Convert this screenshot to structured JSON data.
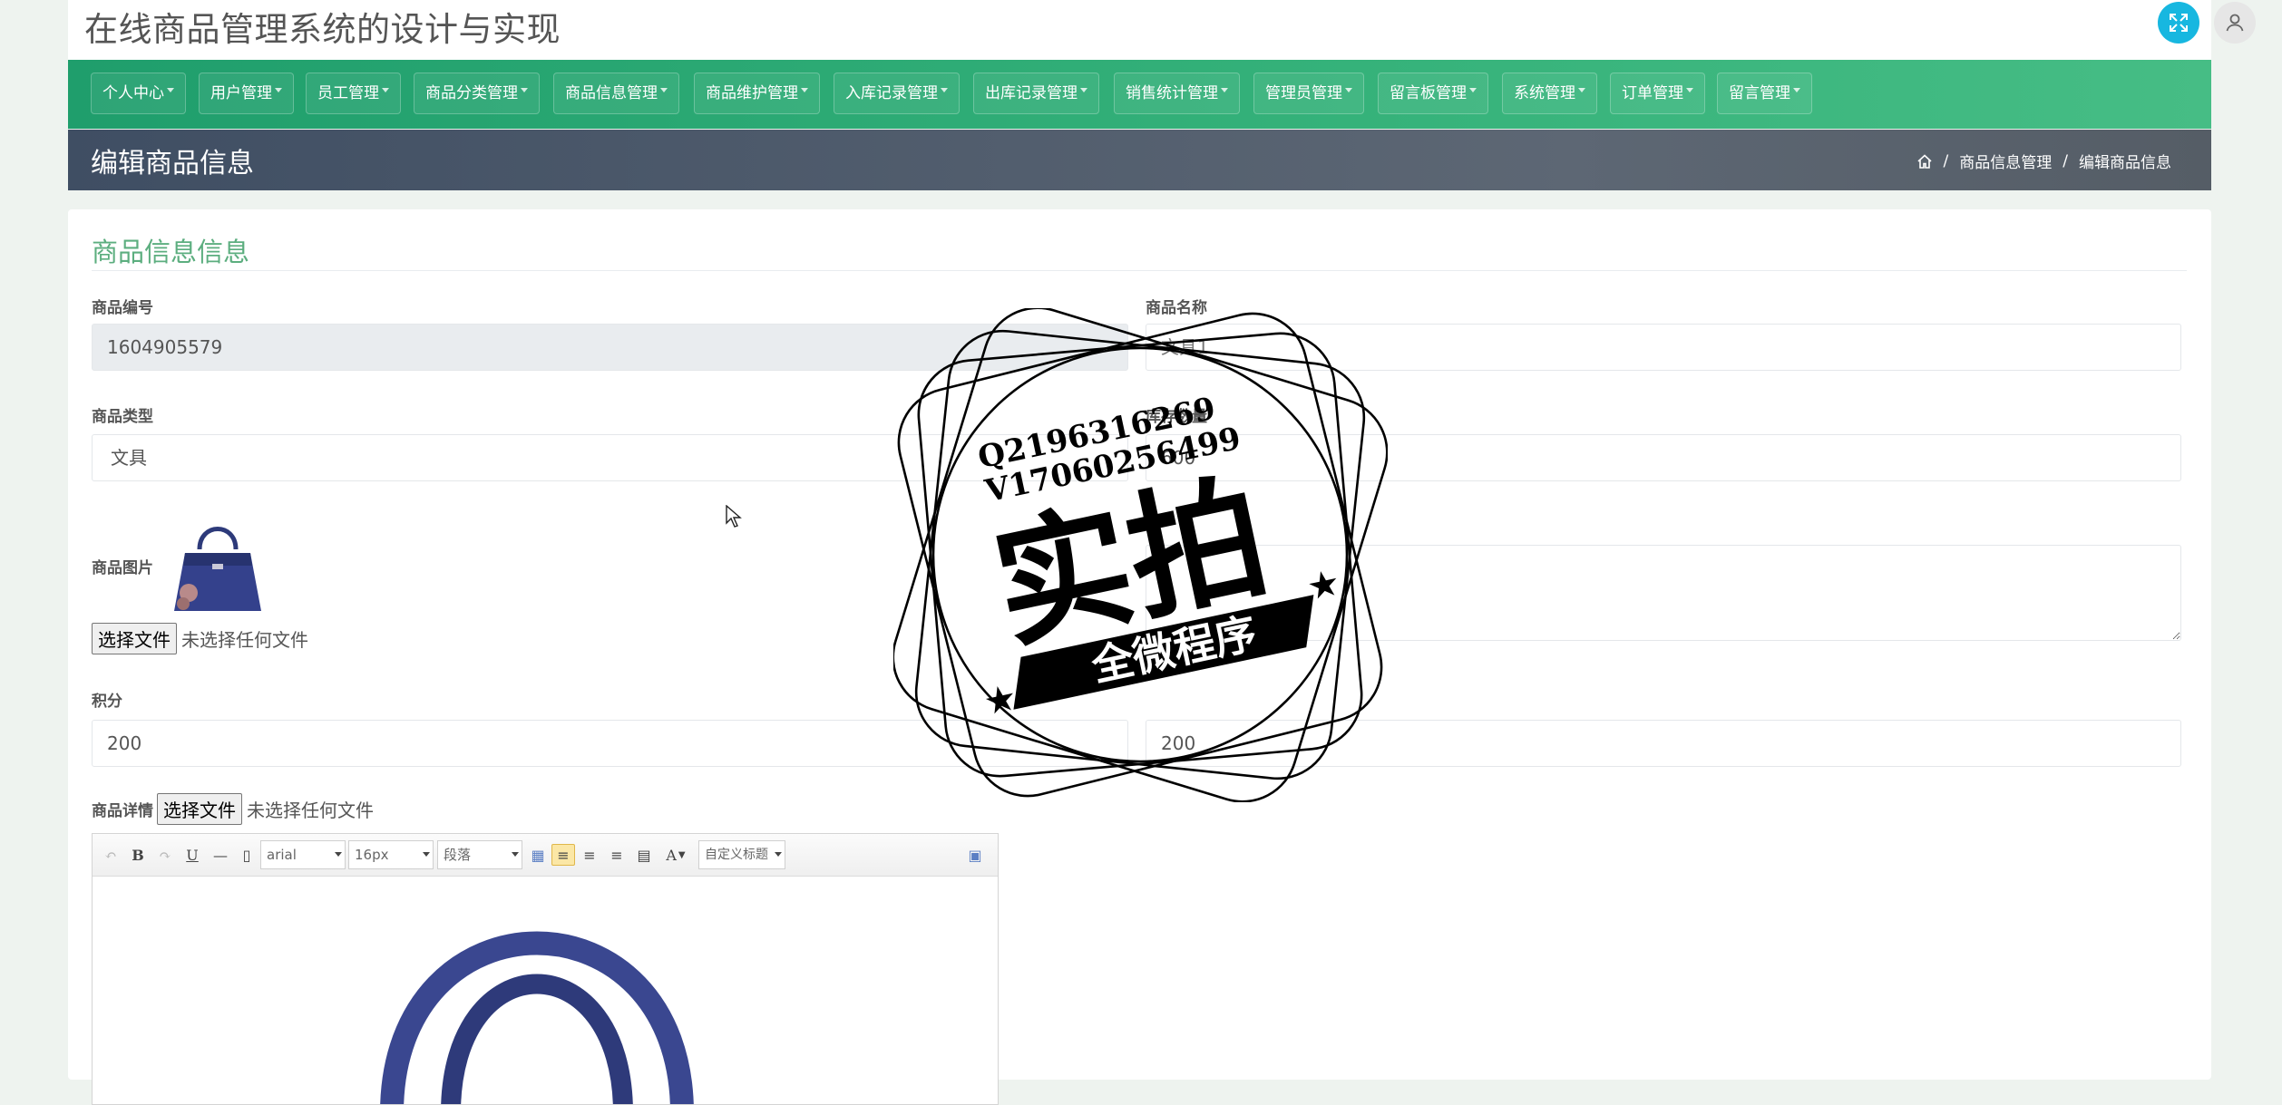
{
  "header": {
    "app_title": "在线商品管理系统的设计与实现",
    "fullscreen_icon": "expand-icon",
    "user_icon": "user-icon"
  },
  "nav": {
    "items": [
      {
        "label": "个人中心"
      },
      {
        "label": "用户管理"
      },
      {
        "label": "员工管理"
      },
      {
        "label": "商品分类管理"
      },
      {
        "label": "商品信息管理"
      },
      {
        "label": "商品维护管理"
      },
      {
        "label": "入库记录管理"
      },
      {
        "label": "出库记录管理"
      },
      {
        "label": "销售统计管理"
      },
      {
        "label": "管理员管理"
      },
      {
        "label": "留言板管理"
      },
      {
        "label": "系统管理"
      },
      {
        "label": "订单管理"
      },
      {
        "label": "留言管理"
      }
    ]
  },
  "page": {
    "title": "编辑商品信息",
    "breadcrumb": [
      "商品信息管理",
      "编辑商品信息"
    ],
    "home_icon": "home-icon"
  },
  "form": {
    "section_title": "商品信息信息",
    "product_id_label": "商品编号",
    "product_id_value": "1604905579",
    "product_name_label": "商品名称",
    "product_name_value": "文具1",
    "product_type_label": "商品类型",
    "product_type_value": "文具",
    "stock_label": "库存数量",
    "stock_value": "600",
    "image_label": "商品图片",
    "file_button": "选择文件",
    "no_file_text": "未选择任何文件",
    "points_label": "积分",
    "points_value": "200",
    "price_value": "200",
    "detail_label": "商品详情",
    "detail_file_button": "选择文件",
    "detail_no_file_text": "未选择任何文件"
  },
  "editor": {
    "bold": "B",
    "underline": "U",
    "font_family": "arial",
    "font_size": "16px",
    "paragraph": "段落",
    "font_color": "A",
    "custom_title": "自定义标题"
  },
  "stamp": {
    "qq": "Q2196316269",
    "wechat": "V17060256499",
    "big_text": "实拍",
    "ribbon_text": "全微程序"
  },
  "colors": {
    "nav_green": "#2ea874",
    "accent_cyan": "#17b7e0",
    "section_green": "#5cae7f",
    "pagebar_dark": "#4a5667"
  }
}
